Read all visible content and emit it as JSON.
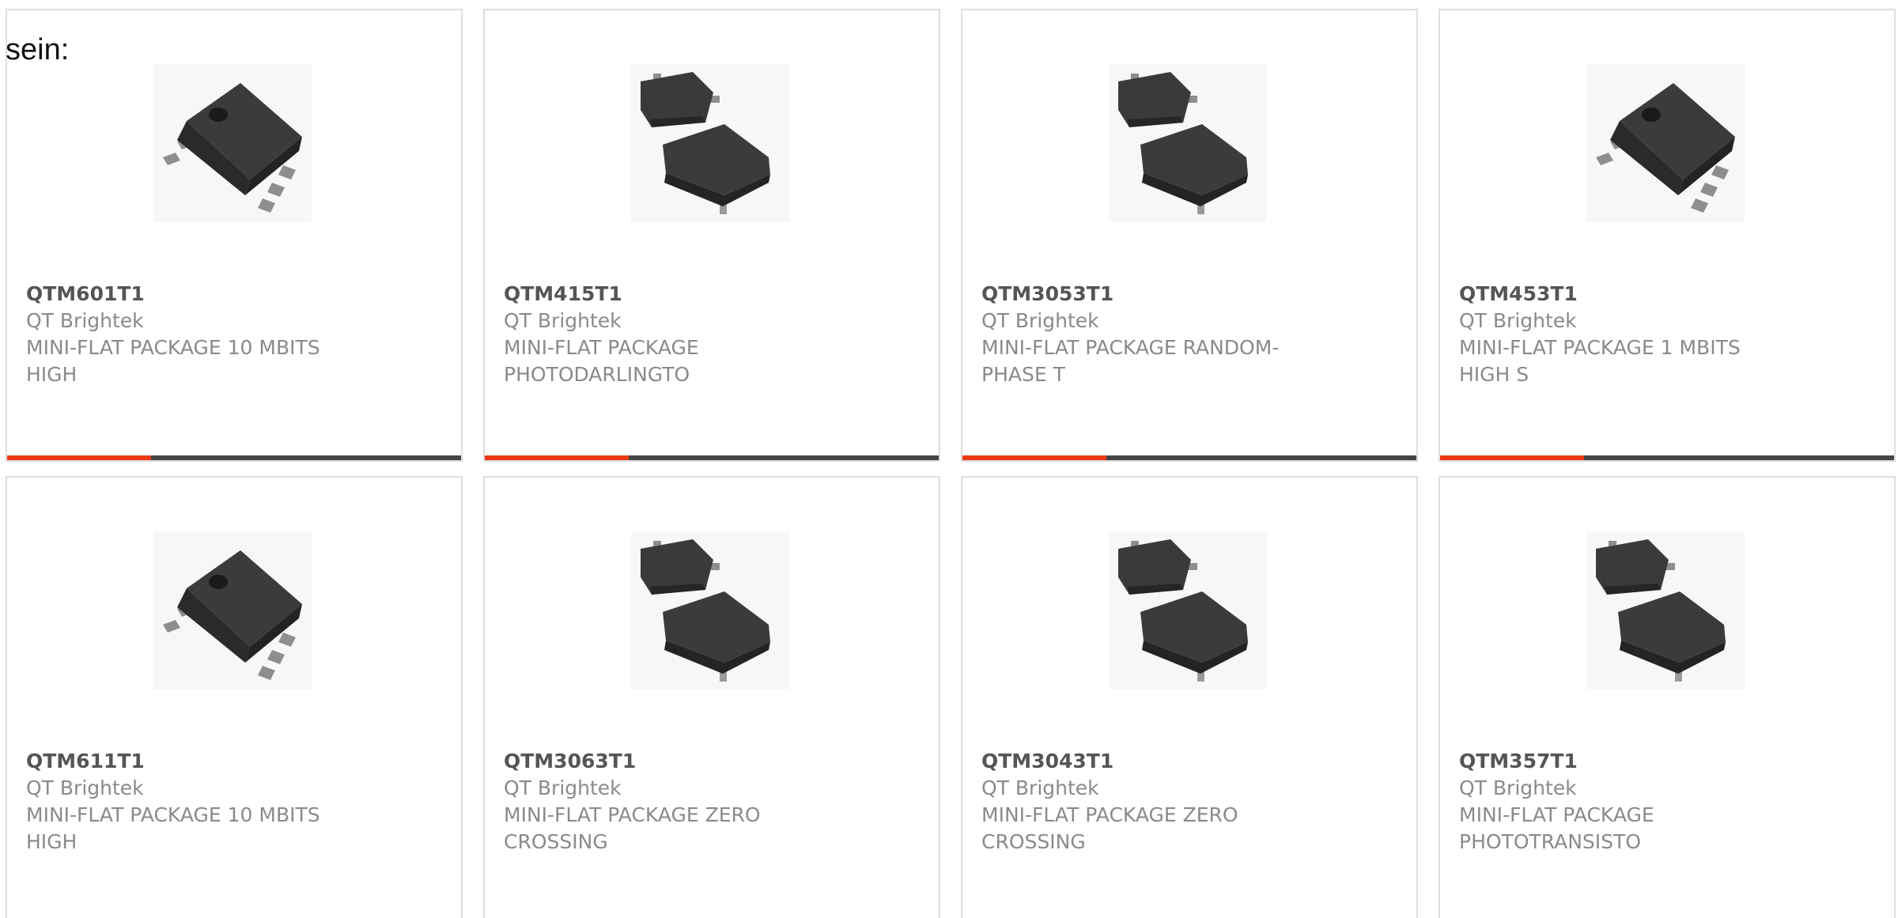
{
  "intro_text": "sein:",
  "colors": {
    "accent_bar": "#ee3b14",
    "bar_track": "#444444",
    "card_border": "#dedede",
    "part_text": "#555555",
    "secondary_text": "#8a8a8a"
  },
  "products": [
    {
      "part": "QTM601T1",
      "maker": "QT Brightek",
      "desc": "MINI-FLAT PACKAGE 10 MBITS HIGH",
      "image": "chip-single-icon",
      "progress": 0.32
    },
    {
      "part": "QTM415T1",
      "maker": "QT Brightek",
      "desc": "MINI-FLAT PACKAGE PHOTODARLINGTO",
      "image": "chip-pair-icon",
      "progress": 0.32
    },
    {
      "part": "QTM3053T1",
      "maker": "QT Brightek",
      "desc": "MINI-FLAT PACKAGE RANDOM-PHASE T",
      "image": "chip-pair-icon",
      "progress": 0.32
    },
    {
      "part": "QTM453T1",
      "maker": "QT Brightek",
      "desc": "MINI-FLAT PACKAGE 1 MBITS HIGH S",
      "image": "chip-single-icon",
      "progress": 0.32
    },
    {
      "part": "QTM611T1",
      "maker": "QT Brightek",
      "desc": "MINI-FLAT PACKAGE 10 MBITS HIGH",
      "image": "chip-single-icon"
    },
    {
      "part": "QTM3063T1",
      "maker": "QT Brightek",
      "desc": "MINI-FLAT PACKAGE ZERO CROSSING",
      "image": "chip-pair-icon"
    },
    {
      "part": "QTM3043T1",
      "maker": "QT Brightek",
      "desc": "MINI-FLAT PACKAGE ZERO CROSSING",
      "image": "chip-pair-icon"
    },
    {
      "part": "QTM357T1",
      "maker": "QT Brightek",
      "desc": "MINI-FLAT PACKAGE PHOTOTRANSISTO",
      "image": "chip-pair-icon"
    }
  ]
}
